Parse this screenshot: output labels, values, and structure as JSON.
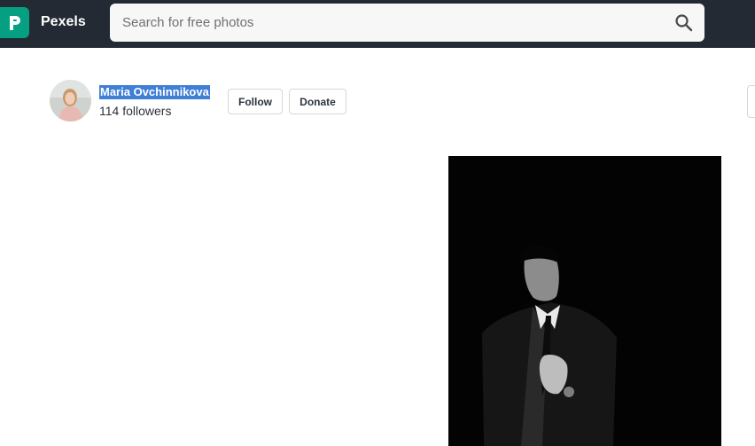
{
  "header": {
    "brand": "Pexels",
    "logo_icon": "pexels-logo-icon",
    "search_placeholder": "Search for free photos",
    "search_icon": "search-icon"
  },
  "profile": {
    "name": "Maria Ovchinnikova",
    "followers": "114 followers",
    "follow_label": "Follow",
    "donate_label": "Donate",
    "avatar_icon": "avatar"
  },
  "colors": {
    "topbar": "#232a34",
    "brand_accent": "#05a081",
    "selection": "#3f7fd6"
  }
}
